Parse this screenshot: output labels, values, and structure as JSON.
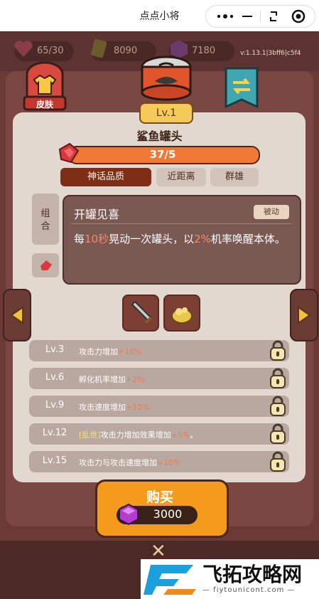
{
  "app_title": "点点小将",
  "resources": {
    "stamina": "65/30",
    "gold": "8090",
    "gems": "7180"
  },
  "version": "v:1.13.1|3bff6|c5f4",
  "skin_label": "皮肤",
  "hero": {
    "level_badge": "Lv.1",
    "name": "鲨鱼罐头",
    "xp_text": "37/5",
    "xp_progress": 1.0
  },
  "tags": {
    "quality": "神话品质",
    "range": "近距离",
    "faction": "群雄"
  },
  "combo_label": "组合",
  "skill": {
    "title": "开罐见喜",
    "type": "被动",
    "desc_p1": "每",
    "desc_n1": "10秒",
    "desc_p2": "晃动一次罐头，以",
    "desc_n2": "2%",
    "desc_p3": "机率唤醒本体。"
  },
  "level_rows": [
    {
      "lv": "Lv.3",
      "text": "攻击力增加",
      "plus": "+10%"
    },
    {
      "lv": "Lv.6",
      "text": "孵化机率增加",
      "plus": "+2%"
    },
    {
      "lv": "Lv.9",
      "text": "攻击速度增加",
      "plus": "+10%"
    },
    {
      "lv": "Lv.12",
      "frame": "[乱世]",
      "text": "攻击力增加效果增加",
      "plus": "+5%",
      "tail": "。"
    },
    {
      "lv": "Lv.15",
      "text": "攻击力与攻击速度增加",
      "plus": "+10%"
    }
  ],
  "buy": {
    "label": "购买",
    "price": "3000"
  },
  "watermark": {
    "text": "飞拓攻略网",
    "url": "— fiytounicont.com —"
  },
  "colors": {
    "accent_orange": "#f49a1d",
    "xp_fill": "#f07a35",
    "highlight": "#f08a6c"
  }
}
